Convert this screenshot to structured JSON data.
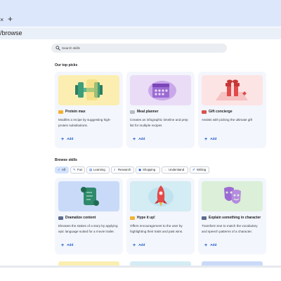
{
  "browser": {
    "close_glyph": "×",
    "new_tab_glyph": "+",
    "url": "/browse",
    "tabbar_color": "#dce7fb",
    "urlbar_color": "#eaf0f8"
  },
  "search": {
    "placeholder": "Search skills",
    "icon": "search-icon"
  },
  "top_picks": {
    "title": "Our top picks",
    "cards": [
      {
        "title": "Protein max",
        "description": "Modifes a recipe by suggesting high-protein substitutions.",
        "add_label": "Add",
        "art_color": "#fbeeb0",
        "icon": "dumbbell-icon"
      },
      {
        "title": "Meal planner",
        "description": "Creates an infographic timeline and prep list for multiple recipes",
        "add_label": "Add",
        "art_color": "#eadcf6",
        "icon": "calendar-icon"
      },
      {
        "title": "Gift concierge",
        "description": "Assists with picking the ultimate gift",
        "add_label": "Add",
        "art_color": "#fde4e4",
        "icon": "gift-icon"
      }
    ]
  },
  "browse": {
    "title": "Browse skills",
    "chips": [
      {
        "label": "All",
        "icon": "check-icon",
        "active": true
      },
      {
        "label": "Fun",
        "icon": "pencil-icon",
        "active": false
      },
      {
        "label": "Learning",
        "icon": "book-icon",
        "active": false
      },
      {
        "label": "Research",
        "icon": "search-icon",
        "active": false
      },
      {
        "label": "Shopping",
        "icon": "bag-icon",
        "active": false
      },
      {
        "label": "Understand",
        "icon": "bulb-icon",
        "active": false
      },
      {
        "label": "Writing",
        "icon": "pen-icon",
        "active": false
      }
    ],
    "cards": [
      {
        "title": "Dramatize content",
        "description": "Elevates the stakes of a story by applying epic language suited for a movie trailer.",
        "add_label": "Add",
        "art_color": "#c9daf8",
        "icon": "scroll-icon"
      },
      {
        "title": "Hype it up!",
        "description": "Offers encouragement to the user by highlighting their traits and past wins.",
        "add_label": "Add",
        "art_color": "#d4ecf4",
        "icon": "rocket-icon"
      },
      {
        "title": "Explain something in character",
        "description": "Transform text to match the vocabulary and speech patterns of a character.",
        "add_label": "Add",
        "art_color": "#dcefd8",
        "icon": "theater-masks-icon"
      }
    ]
  }
}
